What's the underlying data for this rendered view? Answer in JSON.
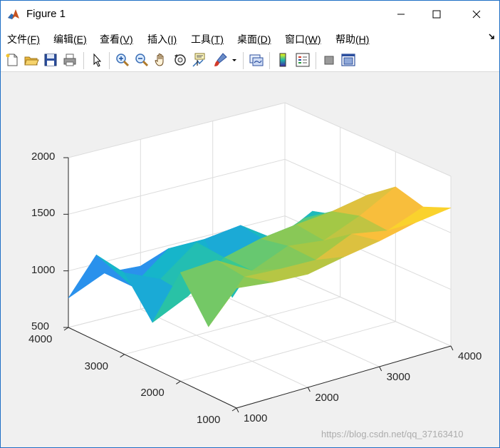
{
  "window": {
    "title": "Figure 1"
  },
  "menu": [
    {
      "label": "文件",
      "key": "(F)"
    },
    {
      "label": "编辑",
      "key": "(E)"
    },
    {
      "label": "查看",
      "key": "(V)"
    },
    {
      "label": "插入",
      "key": "(I)"
    },
    {
      "label": "工具",
      "key": "(T)"
    },
    {
      "label": "桌面",
      "key": "(D)"
    },
    {
      "label": "窗口",
      "key": "(W)"
    },
    {
      "label": "帮助",
      "key": "(H)"
    }
  ],
  "toolbar": {
    "icons": [
      "new-figure-icon",
      "open-file-icon",
      "save-icon",
      "print-icon",
      "edit-plot-arrow-icon",
      "zoom-in-icon",
      "zoom-out-icon",
      "pan-hand-icon",
      "rotate-3d-icon",
      "data-cursor-icon",
      "brush-icon",
      "brush-dropdown-icon",
      "link-plot-icon",
      "colorbar-icon",
      "legend-icon",
      "hide-plot-tools-icon",
      "show-plot-tools-icon"
    ]
  },
  "chart_data": {
    "type": "surface",
    "title": "",
    "xlabel": "",
    "ylabel": "",
    "zlabel": "",
    "colormap": "parula",
    "grid": true,
    "xlim": [
      1000,
      4000
    ],
    "ylim": [
      1000,
      4000
    ],
    "zlim": [
      500,
      2000
    ],
    "x_ticks": [
      "1000",
      "2000",
      "3000",
      "4000"
    ],
    "y_ticks": [
      "1000",
      "2000",
      "3000",
      "4000"
    ],
    "z_ticks": [
      "500",
      "1000",
      "1500",
      "2000"
    ],
    "x": [
      1000,
      1500,
      2000,
      2500,
      3000,
      3500,
      4000
    ],
    "y": [
      1000,
      1500,
      2000,
      2500,
      3000,
      3500,
      4000
    ],
    "z": [
      [
        1560,
        1520,
        1500,
        1560,
        1610,
        1680,
        1720
      ],
      [
        1100,
        1450,
        1430,
        1420,
        1560,
        1500,
        1620
      ],
      [
        1460,
        1480,
        1300,
        1430,
        1390,
        1520,
        1690
      ],
      [
        900,
        1050,
        1300,
        1380,
        1420,
        1450,
        1510
      ],
      [
        1220,
        1080,
        1320,
        750,
        1150,
        1280,
        1220
      ],
      [
        1260,
        900,
        1150,
        1150,
        1190,
        980,
        1150
      ],
      [
        760,
        900,
        880,
        800,
        680,
        900,
        600
      ]
    ]
  },
  "watermark": "https://blog.csdn.net/qq_37163410"
}
